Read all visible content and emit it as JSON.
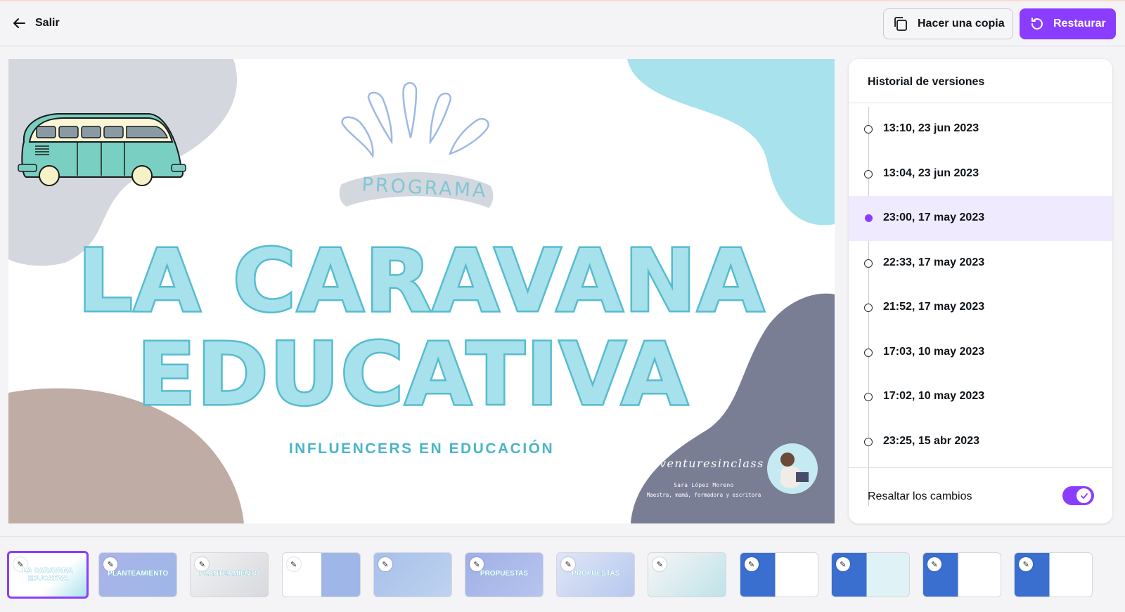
{
  "topbar": {
    "exit_label": "Salir",
    "copy_label": "Hacer una copia",
    "restore_label": "Restaurar"
  },
  "slide": {
    "program_label": "PROGRAMA",
    "title_line1": "LA CARAVANA",
    "title_line2": "EDUCATIVA",
    "subtitle": "INFLUENCERS EN EDUCACIÓN",
    "brand": "adventuresinclass",
    "author": "Sara López Moreno",
    "author_role": "Maestra, mamá, formadora y escritora"
  },
  "history": {
    "title": "Historial de versiones",
    "versions": [
      {
        "label": "13:10, 23 jun 2023",
        "active": false
      },
      {
        "label": "13:04, 23 jun 2023",
        "active": false
      },
      {
        "label": "23:00, 17 may 2023",
        "active": true
      },
      {
        "label": "22:33, 17 may 2023",
        "active": false
      },
      {
        "label": "21:52, 17 may 2023",
        "active": false
      },
      {
        "label": "17:03, 10 may 2023",
        "active": false
      },
      {
        "label": "17:02, 10 may 2023",
        "active": false
      },
      {
        "label": "23:25, 15 abr 2023",
        "active": false
      }
    ],
    "highlight_label": "Resaltar los cambios",
    "highlight_on": true
  },
  "thumbnails": [
    {
      "label": "LA CARAVANA EDUCATIVA",
      "selected": true
    },
    {
      "label": "PLANTEAMIENTO",
      "selected": false
    },
    {
      "label": "PLANTEAMIENTO",
      "selected": false
    },
    {
      "label": "",
      "selected": false
    },
    {
      "label": "",
      "selected": false
    },
    {
      "label": "PROPUESTAS",
      "selected": false
    },
    {
      "label": "PROPUESTAS",
      "selected": false
    },
    {
      "label": "",
      "selected": false
    },
    {
      "label": "",
      "selected": false
    },
    {
      "label": "",
      "selected": false
    },
    {
      "label": "",
      "selected": false
    },
    {
      "label": "",
      "selected": false
    }
  ],
  "colors": {
    "accent": "#8b3dff",
    "active_row": "#efeafd",
    "title_fill": "#a6e1ec",
    "title_stroke": "#56bccf"
  }
}
